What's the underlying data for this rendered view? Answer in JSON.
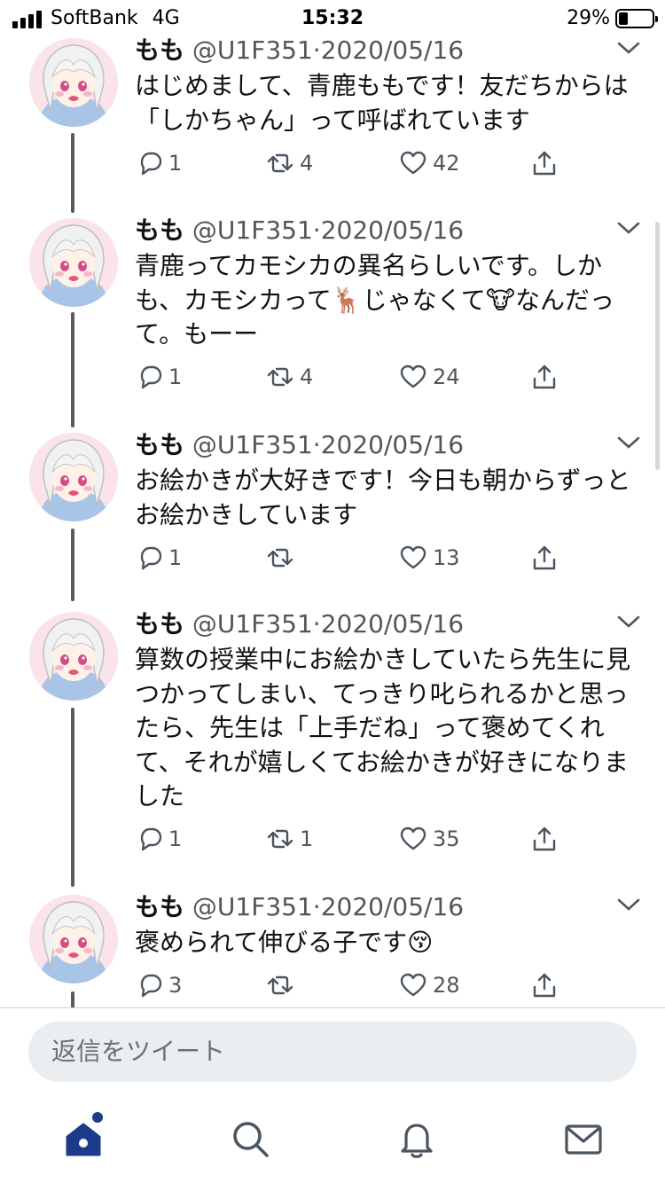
{
  "status_bar": {
    "carrier": "SoftBank",
    "network": "4G",
    "time": "15:32",
    "battery_percent_text": "29%",
    "battery_level": 0.29
  },
  "tweets": [
    {
      "name": "もも",
      "handle": "@U1F351",
      "sep": "·",
      "date": "2020/05/16",
      "text": "はじめまして、青鹿ももです！友だちからは「しかちゃん」って呼ばれています",
      "replies": "1",
      "retweets": "4",
      "likes": "42"
    },
    {
      "name": "もも",
      "handle": "@U1F351",
      "sep": "·",
      "date": "2020/05/16",
      "text_parts": [
        "青鹿ってカモシカの異名らしいです。しかも、カモシカって",
        "🦌",
        "じゃなくて",
        "🐮",
        "なんだって。もーー"
      ],
      "replies": "1",
      "retweets": "4",
      "likes": "24"
    },
    {
      "name": "もも",
      "handle": "@U1F351",
      "sep": "·",
      "date": "2020/05/16",
      "text": "お絵かきが大好きです！今日も朝からずっとお絵かきしています",
      "replies": "1",
      "retweets": "",
      "likes": "13"
    },
    {
      "name": "もも",
      "handle": "@U1F351",
      "sep": "·",
      "date": "2020/05/16",
      "text": "算数の授業中にお絵かきしていたら先生に見つかってしまい、てっきり叱られるかと思ったら、先生は「上手だね」って褒めてくれて、それが嬉しくてお絵かきが好きになりました",
      "replies": "1",
      "retweets": "1",
      "likes": "35"
    },
    {
      "name": "もも",
      "handle": "@U1F351",
      "sep": "·",
      "date": "2020/05/16",
      "text_parts": [
        "褒められて伸びる子です",
        "😚"
      ],
      "replies": "3",
      "retweets": "",
      "likes": "28"
    }
  ],
  "reply_box": {
    "placeholder": "返信をツイート"
  },
  "tab_bar": {
    "items": [
      "home-icon",
      "search-icon",
      "notifications-icon",
      "messages-icon"
    ],
    "active": "home-icon",
    "accent_color": "#1d3b8a"
  },
  "colors": {
    "text": "#111111",
    "secondary_text": "#555555",
    "thread_line": "#5a5a5a"
  }
}
